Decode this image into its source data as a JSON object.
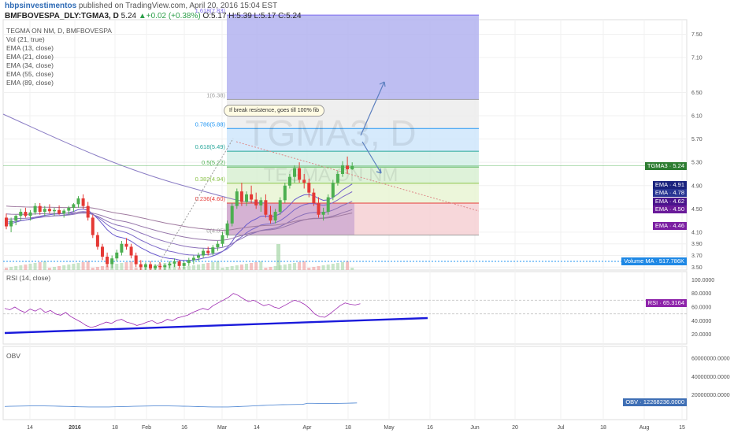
{
  "header": {
    "author": "hbpsinvestimentos",
    "published": "published on TradingView.com, April 20, 2016 15:04 EST",
    "symbol": "BMFBOVESPA_DLY:TGMA3, D",
    "last": "5.24",
    "change": "▲+0.02 (+0.38%)",
    "ohlc": "O:5.17 H:5.39 L:5.17 C:5.24"
  },
  "legend": {
    "title": "TEGMA     ON     NM, D, BMFBOVESPA",
    "items": [
      "Vol (21, true)",
      "EMA (13, close)",
      "EMA (21, close)",
      "EMA (34, close)",
      "EMA (55, close)",
      "EMA (89, close)"
    ]
  },
  "watermark": {
    "line1": "TGMA3, D",
    "line2": "TEGMA ON NM"
  },
  "callout": "If break resistence, goes till 100% fib",
  "fib_levels": [
    {
      "label": "1.618(7.83)",
      "price": 7.83,
      "color": "#7b68ee"
    },
    {
      "label": "1(6.38)",
      "price": 6.38,
      "color": "#9e9e9e"
    },
    {
      "label": "0.786(5.88)",
      "price": 5.88,
      "color": "#2196f3"
    },
    {
      "label": "0.618(5.49)",
      "price": 5.49,
      "color": "#26a69a"
    },
    {
      "label": "0.5(5.22)",
      "price": 5.22,
      "color": "#4caf50"
    },
    {
      "label": "0.382(4.94)",
      "price": 4.94,
      "color": "#8bc34a"
    },
    {
      "label": "0.236(4.60)",
      "price": 4.6,
      "color": "#e53935"
    },
    {
      "label": "0(4.05)",
      "price": 4.05,
      "color": "#9e9e9e"
    }
  ],
  "price_axis": [
    "7.50",
    "7.10",
    "6.50",
    "6.10",
    "5.70",
    "5.30",
    "4.90",
    "4.50",
    "4.10",
    "3.90",
    "3.70",
    "3.50"
  ],
  "price_tags": [
    {
      "text": "TGMA3 · 5.24",
      "color": "#2e7d32",
      "price": 5.24
    },
    {
      "text": "EMA · 4.91",
      "color": "#1a237e",
      "price": 4.91
    },
    {
      "text": "EMA · 4.78",
      "color": "#283593",
      "price": 4.78
    },
    {
      "text": "EMA · 4.62",
      "color": "#4a148c",
      "price": 4.62
    },
    {
      "text": "EMA · 4.50",
      "color": "#6a1b9a",
      "price": 4.5
    },
    {
      "text": "EMA · 4.46",
      "color": "#7b1fa2",
      "price": 4.46
    }
  ],
  "volume_tag": "Volume MA · 517.786K",
  "rsi": {
    "label": "RSI (14, close)",
    "axis": [
      "100.0000",
      "80.0000",
      "60.0000",
      "40.0000",
      "20.0000"
    ],
    "tag": "RSI · 65.3164"
  },
  "obv": {
    "label": "OBV",
    "axis": [
      "60000000.0000",
      "40000000.0000",
      "20000000.0000"
    ],
    "tag": "OBV · 12268236.0000"
  },
  "time_axis": [
    "14",
    "2016",
    "18",
    "Feb",
    "16",
    "Mar",
    "14",
    "Apr",
    "18",
    "May",
    "16",
    "Jun",
    "20",
    "Jul",
    "18",
    "Aug",
    "15"
  ],
  "colors": {
    "up": "#4caf50",
    "down": "#e53935",
    "rsi_line": "#9c27b0",
    "trendline": "#1a1adb",
    "obv_line": "#5b8fd6"
  },
  "chart_data": {
    "type": "candlestick",
    "symbol": "TGMA3",
    "interval": "D",
    "ylim": [
      3.45,
      7.75
    ],
    "candles": [
      [
        4.35,
        4.42,
        4.15,
        4.2
      ],
      [
        4.2,
        4.35,
        4.1,
        4.3
      ],
      [
        4.3,
        4.4,
        4.22,
        4.38
      ],
      [
        4.38,
        4.5,
        4.3,
        4.45
      ],
      [
        4.45,
        4.52,
        4.35,
        4.38
      ],
      [
        4.38,
        4.48,
        4.3,
        4.44
      ],
      [
        4.44,
        4.6,
        4.4,
        4.55
      ],
      [
        4.55,
        4.6,
        4.4,
        4.45
      ],
      [
        4.45,
        4.55,
        4.38,
        4.5
      ],
      [
        4.5,
        4.58,
        4.42,
        4.46
      ],
      [
        4.46,
        4.52,
        4.38,
        4.48
      ],
      [
        4.48,
        4.56,
        4.4,
        4.42
      ],
      [
        4.42,
        4.5,
        4.35,
        4.47
      ],
      [
        4.47,
        4.55,
        4.4,
        4.52
      ],
      [
        4.52,
        4.6,
        4.45,
        4.58
      ],
      [
        4.58,
        4.72,
        4.52,
        4.68
      ],
      [
        4.68,
        4.75,
        4.5,
        4.55
      ],
      [
        4.55,
        4.62,
        4.3,
        4.35
      ],
      [
        4.35,
        4.4,
        4.0,
        4.05
      ],
      [
        4.05,
        4.1,
        3.8,
        3.85
      ],
      [
        3.85,
        3.9,
        3.62,
        3.68
      ],
      [
        3.68,
        3.75,
        3.5,
        3.55
      ],
      [
        3.55,
        3.7,
        3.48,
        3.65
      ],
      [
        3.65,
        3.8,
        3.6,
        3.75
      ],
      [
        3.75,
        3.95,
        3.7,
        3.9
      ],
      [
        3.9,
        4.0,
        3.8,
        3.85
      ],
      [
        3.85,
        3.9,
        3.65,
        3.7
      ],
      [
        3.7,
        3.75,
        3.5,
        3.55
      ],
      [
        3.55,
        3.62,
        3.45,
        3.5
      ],
      [
        3.5,
        3.58,
        3.45,
        3.55
      ],
      [
        3.55,
        3.6,
        3.45,
        3.48
      ],
      [
        3.48,
        3.55,
        3.45,
        3.52
      ],
      [
        3.52,
        3.58,
        3.46,
        3.5
      ],
      [
        3.5,
        3.56,
        3.45,
        3.53
      ],
      [
        3.53,
        3.6,
        3.48,
        3.56
      ],
      [
        3.56,
        3.65,
        3.5,
        3.6
      ],
      [
        3.6,
        3.62,
        3.48,
        3.52
      ],
      [
        3.52,
        3.6,
        3.47,
        3.57
      ],
      [
        3.57,
        3.66,
        3.52,
        3.62
      ],
      [
        3.62,
        3.7,
        3.55,
        3.66
      ],
      [
        3.66,
        3.75,
        3.6,
        3.7
      ],
      [
        3.7,
        3.82,
        3.66,
        3.78
      ],
      [
        3.78,
        3.85,
        3.7,
        3.74
      ],
      [
        3.74,
        3.88,
        3.7,
        3.84
      ],
      [
        3.84,
        3.95,
        3.78,
        3.9
      ],
      [
        3.9,
        4.1,
        3.85,
        4.05
      ],
      [
        4.05,
        4.3,
        4.0,
        4.25
      ],
      [
        4.25,
        4.6,
        4.2,
        4.55
      ],
      [
        4.55,
        4.85,
        4.5,
        4.8
      ],
      [
        4.8,
        4.95,
        4.55,
        4.62
      ],
      [
        4.62,
        4.8,
        4.55,
        4.75
      ],
      [
        4.75,
        4.9,
        4.6,
        4.66
      ],
      [
        4.66,
        4.78,
        4.5,
        4.56
      ],
      [
        4.56,
        4.7,
        4.45,
        4.65
      ],
      [
        4.65,
        4.75,
        4.35,
        4.4
      ],
      [
        4.4,
        4.55,
        4.25,
        4.3
      ],
      [
        4.3,
        4.5,
        4.25,
        4.45
      ],
      [
        4.45,
        4.7,
        4.4,
        4.65
      ],
      [
        4.65,
        4.95,
        4.6,
        4.9
      ],
      [
        4.9,
        5.1,
        4.85,
        5.05
      ],
      [
        5.05,
        5.25,
        4.95,
        5.2
      ],
      [
        5.2,
        5.3,
        4.95,
        5.0
      ],
      [
        5.0,
        5.1,
        4.85,
        4.95
      ],
      [
        4.95,
        5.02,
        4.7,
        4.78
      ],
      [
        4.78,
        4.85,
        4.55,
        4.6
      ],
      [
        4.6,
        4.7,
        4.35,
        4.4
      ],
      [
        4.4,
        4.52,
        4.3,
        4.45
      ],
      [
        4.45,
        4.75,
        4.4,
        4.7
      ],
      [
        4.7,
        5.0,
        4.65,
        4.95
      ],
      [
        4.95,
        5.15,
        4.9,
        5.1
      ],
      [
        5.1,
        5.32,
        5.05,
        5.25
      ],
      [
        5.25,
        5.4,
        5.1,
        5.18
      ],
      [
        5.18,
        5.3,
        5.17,
        5.24
      ]
    ]
  }
}
